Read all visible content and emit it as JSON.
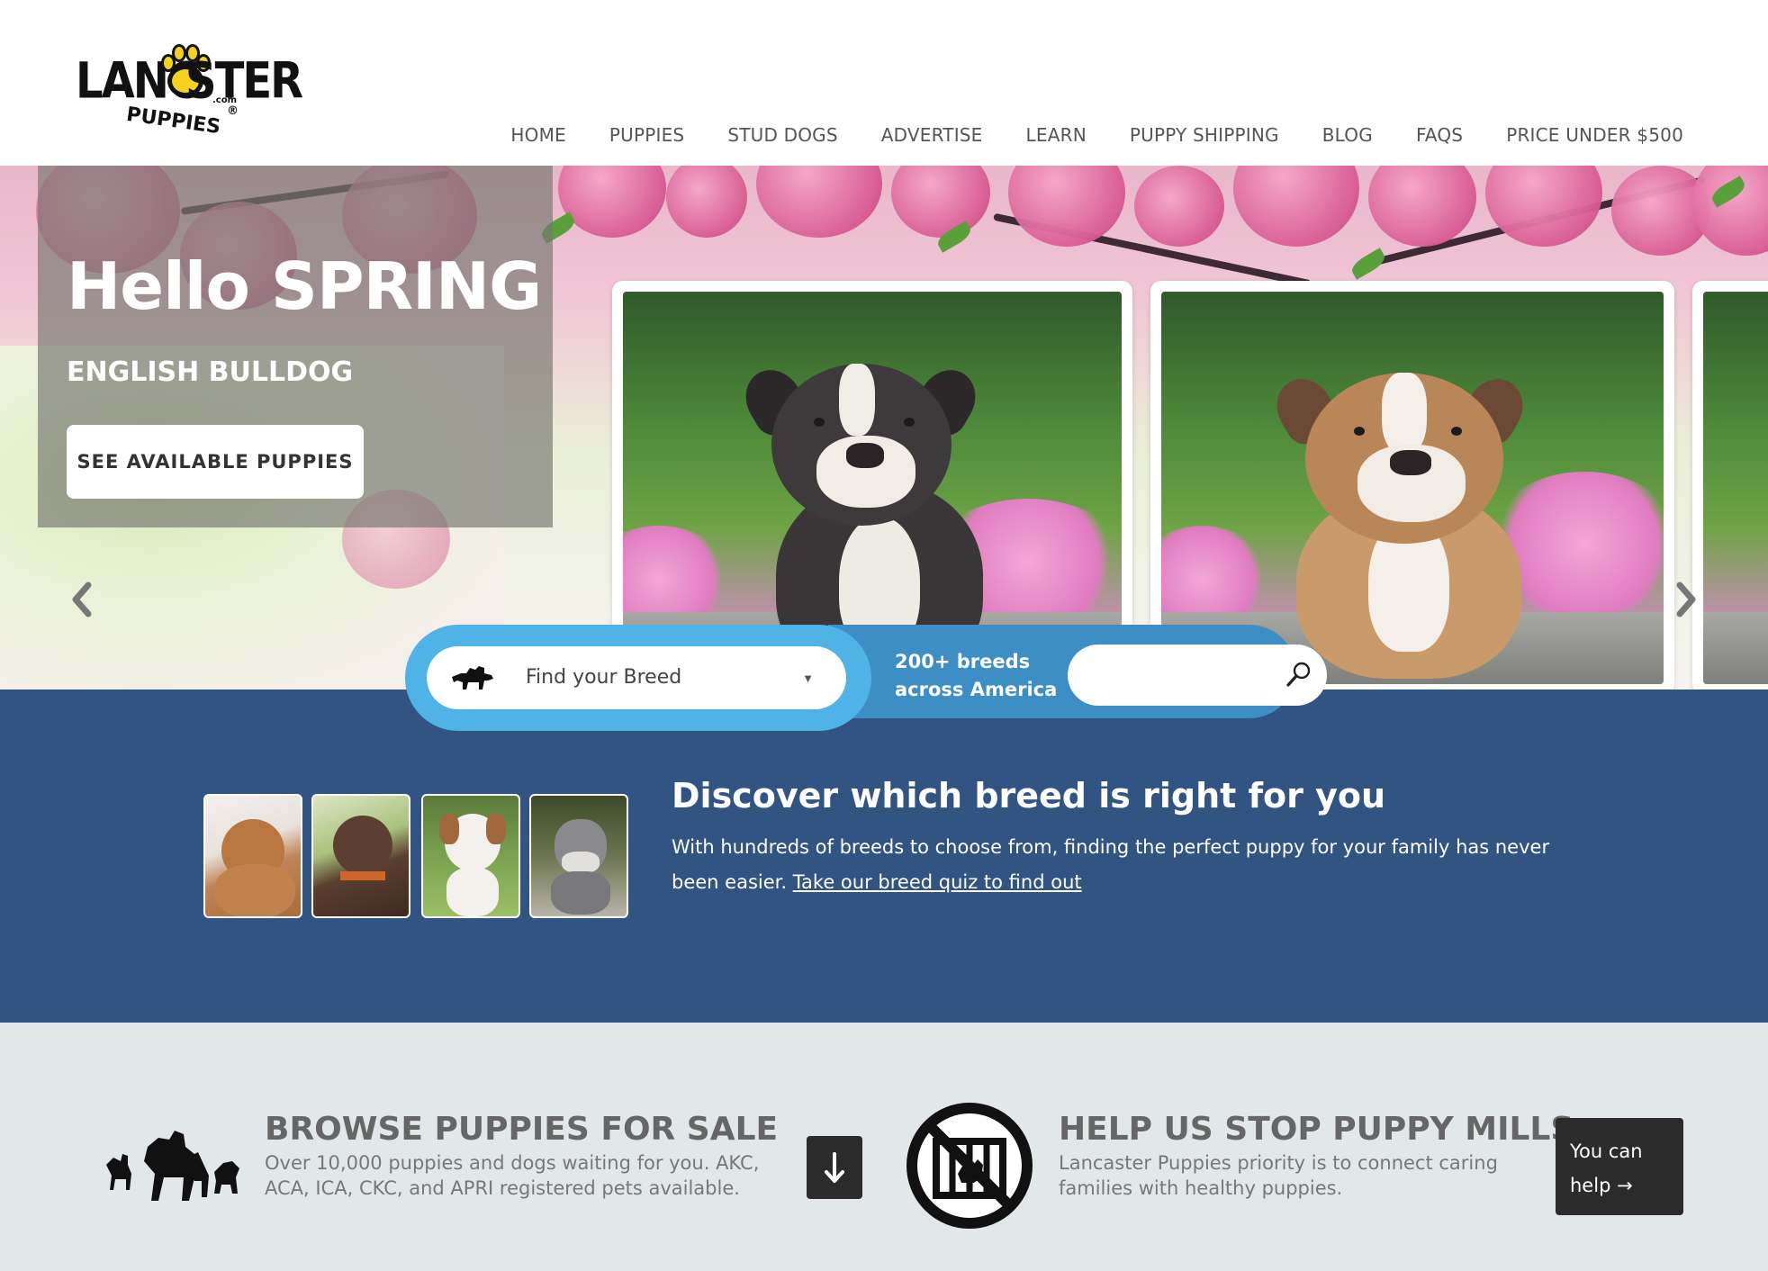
{
  "logo": {
    "text_left": "LANC",
    "text_right": "STER",
    "text_bottom": "PUPPIES",
    "text_com": ".com",
    "text_reg": "®",
    "paw_color": "#f5d21d"
  },
  "nav": {
    "items": [
      "HOME",
      "PUPPIES",
      "STUD DOGS",
      "ADVERTISE",
      "LEARN",
      "PUPPY SHIPPING",
      "BLOG",
      "FAQS",
      "PRICE UNDER $500"
    ]
  },
  "hero": {
    "title": "Hello SPRING",
    "subtitle": "ENGLISH BULLDOG",
    "cta_label": "SEE AVAILABLE PUPPIES",
    "prev_icon": "chevron-left-icon",
    "next_icon": "chevron-right-icon"
  },
  "search": {
    "breed_placeholder": "Find your Breed",
    "breeds_note_line1": "200+ breeds",
    "breeds_note_line2": "across America",
    "input_value": "",
    "search_icon": "magnifier-icon",
    "colors": {
      "outer": "#4fb3e8",
      "inner": "#3d8ec4"
    }
  },
  "discover": {
    "title": "Discover which breed is right for you",
    "text": "With hundreds of breeds to choose from, finding the perfect puppy for your family has never been easier. ",
    "link": "Take our breed quiz to find out",
    "background": "#325482"
  },
  "bottom": {
    "browse_title": "BROWSE PUPPIES FOR SALE",
    "browse_text": "Over 10,000 puppies and dogs waiting for you. AKC, ACA, ICA, CKC, and APRI registered pets available.",
    "down_icon": "arrow-down-icon",
    "mill_title": "HELP US STOP PUPPY MILLS",
    "mill_text": "Lancaster Puppies priority is to connect caring families with healthy puppies.",
    "help_line1": "You can",
    "help_line2": "help →"
  }
}
